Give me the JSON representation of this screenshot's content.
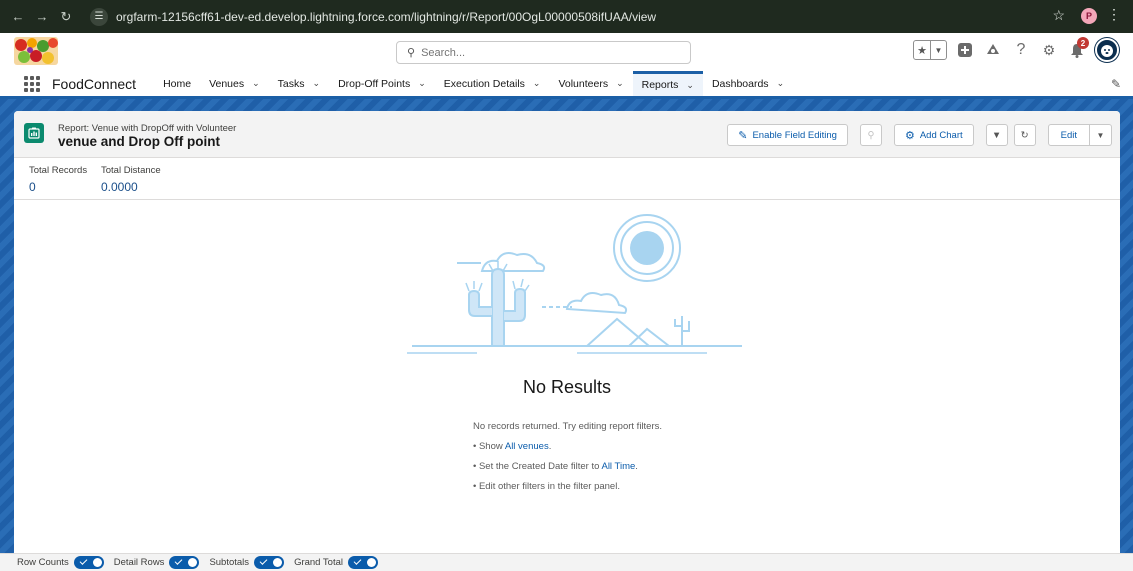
{
  "browser": {
    "url": "orgfarm-12156cff61-dev-ed.develop.lightning.force.com/lightning/r/Report/00OgL00000508ifUAA/view",
    "profile_initial": "P"
  },
  "header": {
    "search_placeholder": "Search...",
    "notification_count": "2"
  },
  "app": {
    "name": "FoodConnect",
    "nav": [
      {
        "label": "Home",
        "has_menu": false
      },
      {
        "label": "Venues",
        "has_menu": true
      },
      {
        "label": "Tasks",
        "has_menu": true
      },
      {
        "label": "Drop-Off Points",
        "has_menu": true
      },
      {
        "label": "Execution Details",
        "has_menu": true
      },
      {
        "label": "Volunteers",
        "has_menu": true
      },
      {
        "label": "Reports",
        "has_menu": true,
        "active": true
      },
      {
        "label": "Dashboards",
        "has_menu": true
      }
    ]
  },
  "report": {
    "type_label": "Report: Venue with DropOff with Volunteer",
    "name": "venue and Drop Off point",
    "actions": {
      "enable_field_editing": "Enable Field Editing",
      "add_chart": "Add Chart",
      "edit": "Edit"
    },
    "summary": {
      "total_records_label": "Total Records",
      "total_records_value": "0",
      "total_distance_label": "Total Distance",
      "total_distance_value": "0.0000"
    },
    "empty": {
      "title": "No Results",
      "message": "No records returned. Try editing report filters.",
      "show_prefix": "• Show ",
      "show_link": "All venues",
      "show_suffix": ".",
      "date_prefix": "• Set the Created Date filter to ",
      "date_link": "All Time",
      "date_suffix": ".",
      "other": "• Edit other filters in the filter panel."
    }
  },
  "footer": {
    "toggles": [
      {
        "label": "Row Counts",
        "on": true
      },
      {
        "label": "Detail Rows",
        "on": true
      },
      {
        "label": "Subtotals",
        "on": true
      },
      {
        "label": "Grand Total",
        "on": true
      }
    ]
  },
  "colors": {
    "accent": "#0b5cab",
    "report_icon": "#0b8a6e",
    "browser_bar": "#1f2a1f",
    "illustration": "#a8d4f0"
  }
}
